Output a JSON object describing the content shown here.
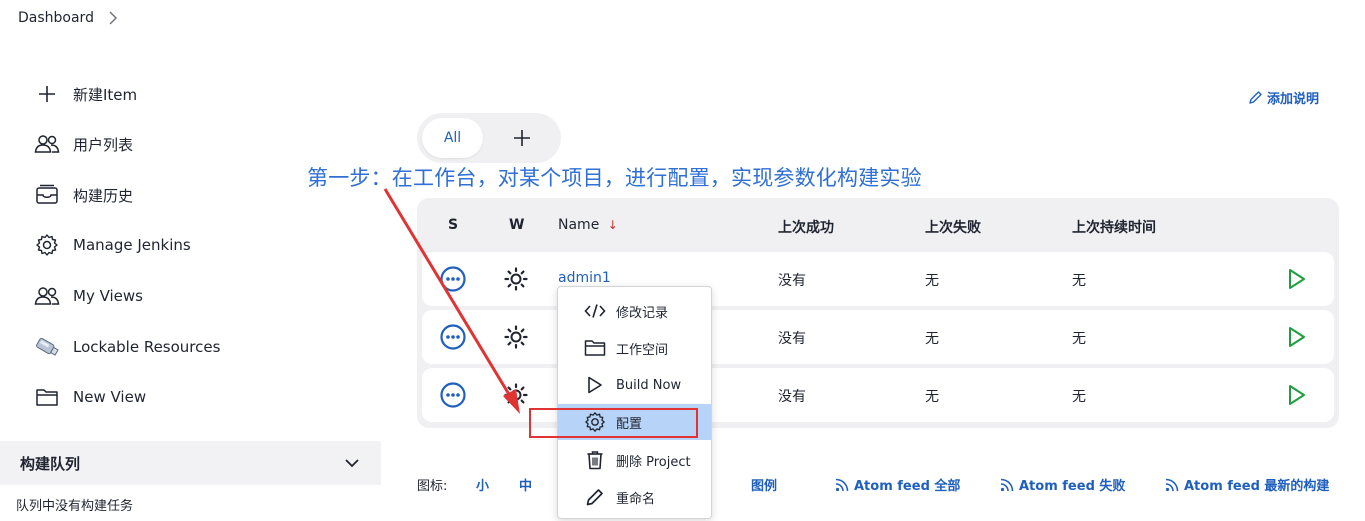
{
  "breadcrumb": {
    "root": "Dashboard"
  },
  "sidebar": {
    "items": [
      {
        "label": "新建Item",
        "icon": "plus-icon"
      },
      {
        "label": "用户列表",
        "icon": "users-icon"
      },
      {
        "label": "构建历史",
        "icon": "inbox-icon"
      },
      {
        "label": "Manage Jenkins",
        "icon": "gear-icon"
      },
      {
        "label": "My Views",
        "icon": "users-icon"
      },
      {
        "label": "Lockable Resources",
        "icon": "usb-drive-icon"
      },
      {
        "label": "New View",
        "icon": "folder-icon"
      }
    ]
  },
  "queue": {
    "title": "构建队列",
    "empty_text": "队列中没有构建任务"
  },
  "header": {
    "add_description": "添加说明"
  },
  "tabs": {
    "all": "All",
    "add": "+"
  },
  "annotation": "第一步：在工作台，对某个项目，进行配置，实现参数化构建实验",
  "table": {
    "headers": {
      "s": "S",
      "w": "W",
      "name": "Name",
      "sort_arrow": "↓",
      "last_success": "上次成功",
      "last_failure": "上次失败",
      "last_duration": "上次持续时间"
    },
    "rows": [
      {
        "name": "admin1",
        "last_success": "没有",
        "last_failure": "无",
        "last_duration": "无"
      },
      {
        "name": "",
        "last_success": "没有",
        "last_failure": "无",
        "last_duration": "无"
      },
      {
        "name": "",
        "last_success": "没有",
        "last_failure": "无",
        "last_duration": "无"
      }
    ]
  },
  "context_menu": {
    "items": [
      {
        "label": "修改记录",
        "icon": "code-icon"
      },
      {
        "label": "工作空间",
        "icon": "folder-icon"
      },
      {
        "label": "Build Now",
        "icon": "play-icon"
      },
      {
        "label": "配置",
        "icon": "gear-icon"
      },
      {
        "label": "删除 Project",
        "icon": "trash-icon"
      },
      {
        "label": "重命名",
        "icon": "pencil-icon"
      }
    ],
    "active_index": 3
  },
  "footer": {
    "icon_label": "图标:",
    "size_small": "小",
    "size_medium": "中",
    "legend": "图例",
    "atom_all": "Atom feed 全部",
    "atom_failed": "Atom feed 失败",
    "atom_latest": "Atom feed 最新的构建"
  },
  "colors": {
    "link": "#1f5fbf",
    "annotation": "#2f6fd6",
    "highlight": "#e03434",
    "play": "#1e9e3e",
    "menu_active": "#b7d3f7"
  }
}
